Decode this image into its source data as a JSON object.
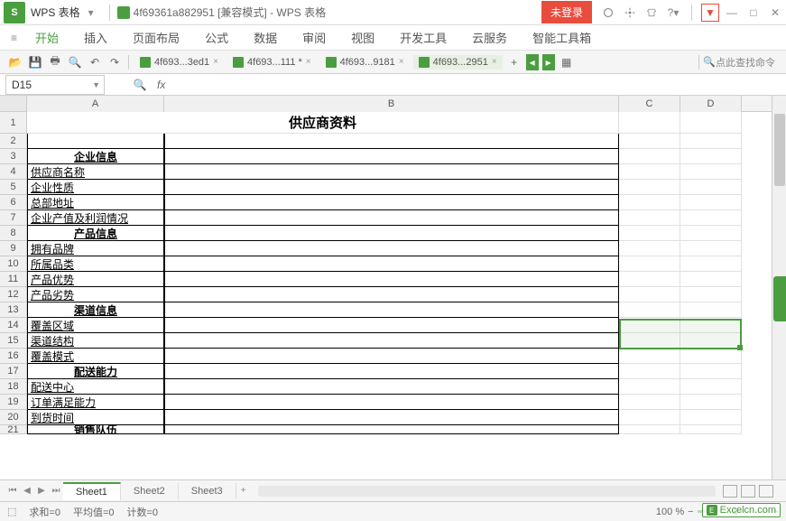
{
  "titlebar": {
    "app_name": "WPS 表格",
    "doc_title": "4f69361a882951 [兼容模式] - WPS 表格",
    "login_label": "未登录"
  },
  "menubar": {
    "items": [
      "开始",
      "插入",
      "页面布局",
      "公式",
      "数据",
      "审阅",
      "视图",
      "开发工具",
      "云服务",
      "智能工具箱"
    ]
  },
  "doc_tabs": [
    {
      "label": "4f693...3ed1",
      "close": "×",
      "active": false
    },
    {
      "label": "4f693...111 *",
      "close": "×",
      "active": false
    },
    {
      "label": "4f693...9181",
      "close": "×",
      "active": false
    },
    {
      "label": "4f693...2951",
      "close": "×",
      "active": true
    }
  ],
  "toolbar": {
    "search_placeholder": "点此查找命令"
  },
  "formula_bar": {
    "name_box": "D15",
    "fx": "fx"
  },
  "columns": [
    "A",
    "B",
    "C",
    "D"
  ],
  "rows": [
    {
      "n": "1",
      "tall": true,
      "title": "供应商资料"
    },
    {
      "n": "2",
      "a": "",
      "b": ""
    },
    {
      "n": "3",
      "a": "企业信息",
      "section": true
    },
    {
      "n": "4",
      "a": "供应商名称"
    },
    {
      "n": "5",
      "a": "企业性质"
    },
    {
      "n": "6",
      "a": "总部地址"
    },
    {
      "n": "7",
      "a": "企业产值及利润情况"
    },
    {
      "n": "8",
      "a": "产品信息",
      "section": true
    },
    {
      "n": "9",
      "a": "拥有品牌"
    },
    {
      "n": "10",
      "a": "所属品类"
    },
    {
      "n": "11",
      "a": "产品优势"
    },
    {
      "n": "12",
      "a": "产品劣势"
    },
    {
      "n": "13",
      "a": "渠道信息",
      "section": true
    },
    {
      "n": "14",
      "a": "覆盖区域"
    },
    {
      "n": "15",
      "a": "渠道结构"
    },
    {
      "n": "16",
      "a": "覆盖模式"
    },
    {
      "n": "17",
      "a": "配送能力",
      "section": true
    },
    {
      "n": "18",
      "a": "配送中心"
    },
    {
      "n": "19",
      "a": "订单满足能力"
    },
    {
      "n": "20",
      "a": "到货时间"
    },
    {
      "n": "21",
      "a": "销售队伍",
      "section": true,
      "partial": true
    }
  ],
  "sheet_tabs": [
    "Sheet1",
    "Sheet2",
    "Sheet3"
  ],
  "statusbar": {
    "indicator": "⬚",
    "sum": "求和=0",
    "avg": "平均值=0",
    "count": "计数=0",
    "zoom": "100 %"
  },
  "watermark": "Excelcn.com"
}
